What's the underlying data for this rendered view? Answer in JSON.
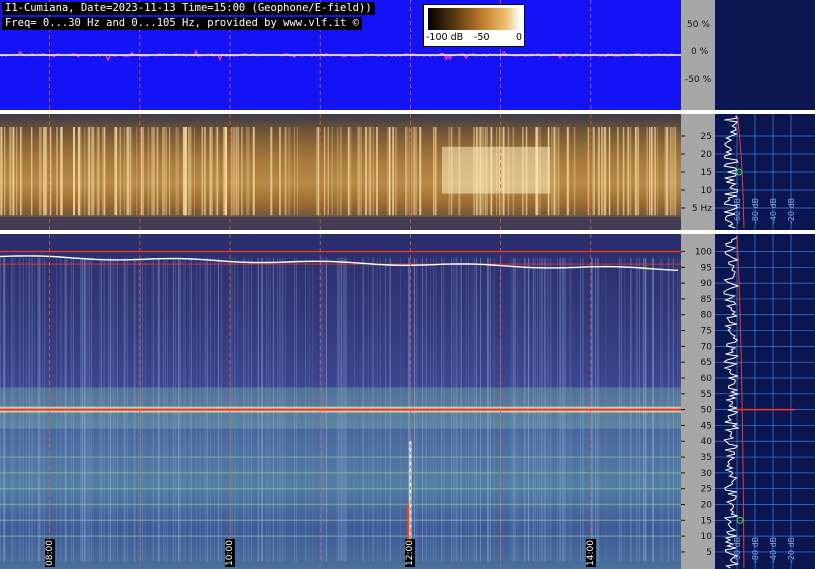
{
  "header": {
    "line1": "I1-Cumiana, Date=2023-11-13 Time=15:00 (Geophone/E-field))",
    "line2": "Freq= 0...30 Hz and 0...105 Hz, provided by www.vlf.it ©"
  },
  "colorbar": {
    "labels": [
      "-100 dB",
      "-50",
      "0"
    ],
    "colors": [
      "#000000",
      "#c08030",
      "#ffffff"
    ]
  },
  "chart_data": [
    {
      "type": "line",
      "panel": "waveform",
      "ylabel": "",
      "ytick_labels": [
        "50 %",
        "0 %",
        "-50 %"
      ],
      "ylim": [
        -100,
        100
      ],
      "background": "#1313f5",
      "trace_color": "#ff40c0"
    },
    {
      "type": "heatmap",
      "panel": "spectrogram 0...30 Hz",
      "ytick_labels": [
        "25",
        "20",
        "15",
        "10",
        "5 Hz"
      ],
      "yticks": [
        25,
        20,
        15,
        10,
        5
      ],
      "ylim": [
        0,
        30
      ],
      "side_labels": [
        "-60 dB",
        "-80 dB",
        "-40 dB",
        "-20 dB"
      ]
    },
    {
      "type": "heatmap",
      "panel": "spectrogram 0...105 Hz",
      "ytick_labels": [
        "100",
        "95",
        "90",
        "85",
        "80",
        "75",
        "70",
        "65",
        "60",
        "55",
        "50",
        "45",
        "40",
        "35",
        "30",
        "25",
        "20",
        "15",
        "10",
        "5"
      ],
      "yticks": [
        100,
        95,
        90,
        85,
        80,
        75,
        70,
        65,
        60,
        55,
        50,
        45,
        40,
        35,
        30,
        25,
        20,
        15,
        10,
        5
      ],
      "ylim": [
        0,
        105
      ],
      "time_labels": [
        "08:00",
        "10:00",
        "12:00",
        "14:00"
      ],
      "time_positions_hours": [
        8,
        10,
        12,
        14
      ],
      "xlim_hours": [
        7.45,
        15.0
      ],
      "side_labels": [
        "-60 dB",
        "-80 dB",
        "-40 dB",
        "-20 dB"
      ],
      "hum_line_hz": 50
    }
  ]
}
